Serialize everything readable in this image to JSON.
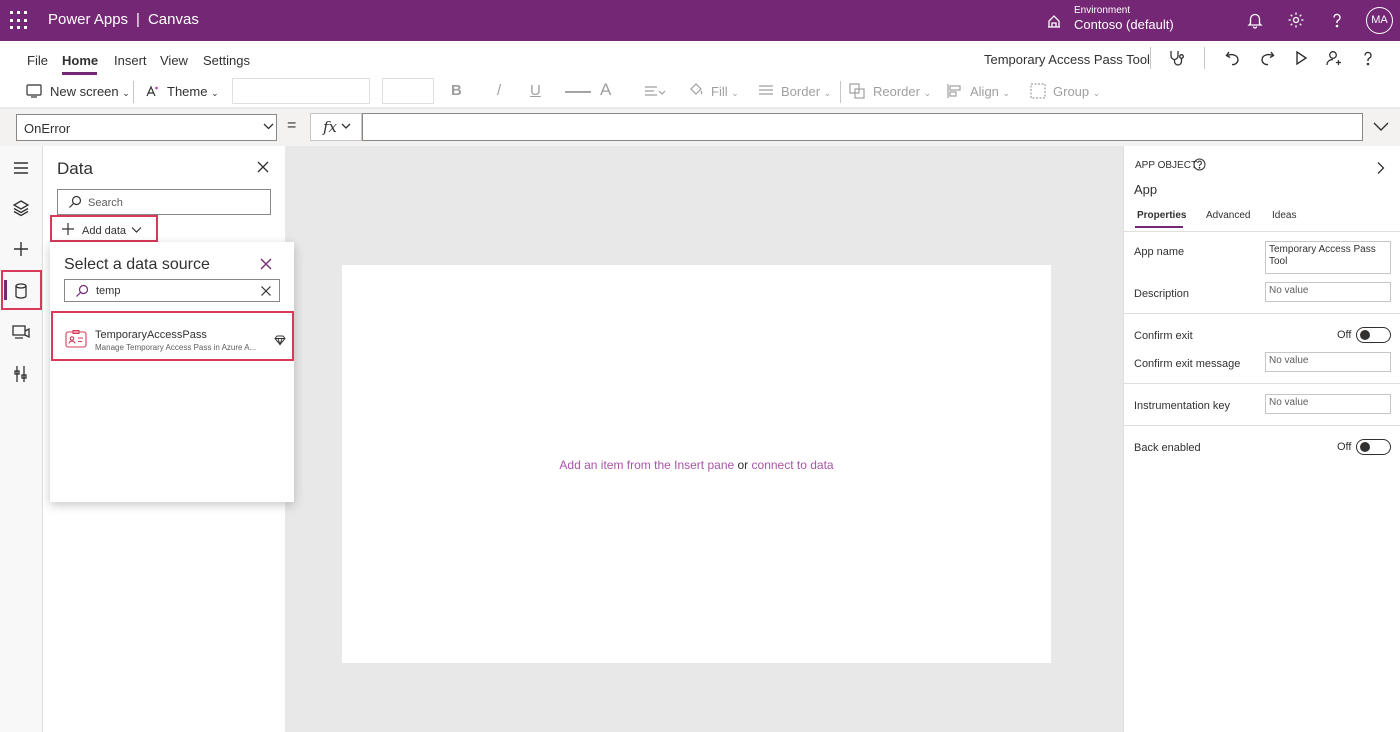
{
  "topbar": {
    "app_name": "Power Apps",
    "separator": "|",
    "studio": "Canvas",
    "environment_label": "Environment",
    "environment_name": "Contoso (default)",
    "avatar_initials": "MA",
    "icons": [
      "waffle-icon",
      "environment-icon",
      "bell-icon",
      "gear-icon",
      "help-icon"
    ]
  },
  "menubar": {
    "items": [
      {
        "label": "File"
      },
      {
        "label": "Home",
        "active": true
      },
      {
        "label": "Insert"
      },
      {
        "label": "View"
      },
      {
        "label": "Settings"
      }
    ],
    "app_title": "Temporary Access Pass Tool",
    "icons": [
      "stethoscope-icon",
      "undo-icon",
      "redo-icon",
      "play-icon",
      "share-user-icon",
      "help-icon"
    ]
  },
  "ribbon": {
    "new_screen": "New screen",
    "theme": "Theme",
    "bold": "B",
    "italic": "/",
    "underline": "U",
    "font_color": "A",
    "fill": "Fill",
    "border": "Border",
    "reorder": "Reorder",
    "align": "Align",
    "group": "Group"
  },
  "formula": {
    "property": "OnError",
    "equals": "=",
    "fx": "fx",
    "value": ""
  },
  "rail": {
    "icons": [
      "hamburger-icon",
      "layers-icon",
      "plus-icon",
      "database-icon",
      "media-icon",
      "tools-icon"
    ],
    "active": "database-icon"
  },
  "data_panel": {
    "title": "Data",
    "search_placeholder": "Search",
    "add_data": "Add data"
  },
  "flyout": {
    "title": "Select a data source",
    "search_value": "temp",
    "connector": {
      "name": "TemporaryAccessPass",
      "description": "Manage Temporary Access Pass in Azure A..."
    }
  },
  "canvas": {
    "hint_prefix": "Add an item from the Insert pane",
    "hint_or": " or ",
    "hint_link": "connect to data"
  },
  "properties": {
    "object_type": "APP OBJECT",
    "object_name": "App",
    "tabs": [
      {
        "label": "Properties",
        "active": true
      },
      {
        "label": "Advanced"
      },
      {
        "label": "Ideas"
      }
    ],
    "app_name_label": "App name",
    "app_name_value": "Temporary Access Pass Tool",
    "description_label": "Description",
    "description_placeholder": "No value",
    "confirm_exit_label": "Confirm exit",
    "confirm_exit_state": "Off",
    "confirm_exit_message_label": "Confirm exit message",
    "confirm_exit_message_placeholder": "No value",
    "instrumentation_key_label": "Instrumentation key",
    "instrumentation_key_placeholder": "No value",
    "back_enabled_label": "Back enabled",
    "back_enabled_state": "Off"
  },
  "colors": {
    "brand": "#742774",
    "highlight": "#d83b5a",
    "link": "#a855a8"
  }
}
